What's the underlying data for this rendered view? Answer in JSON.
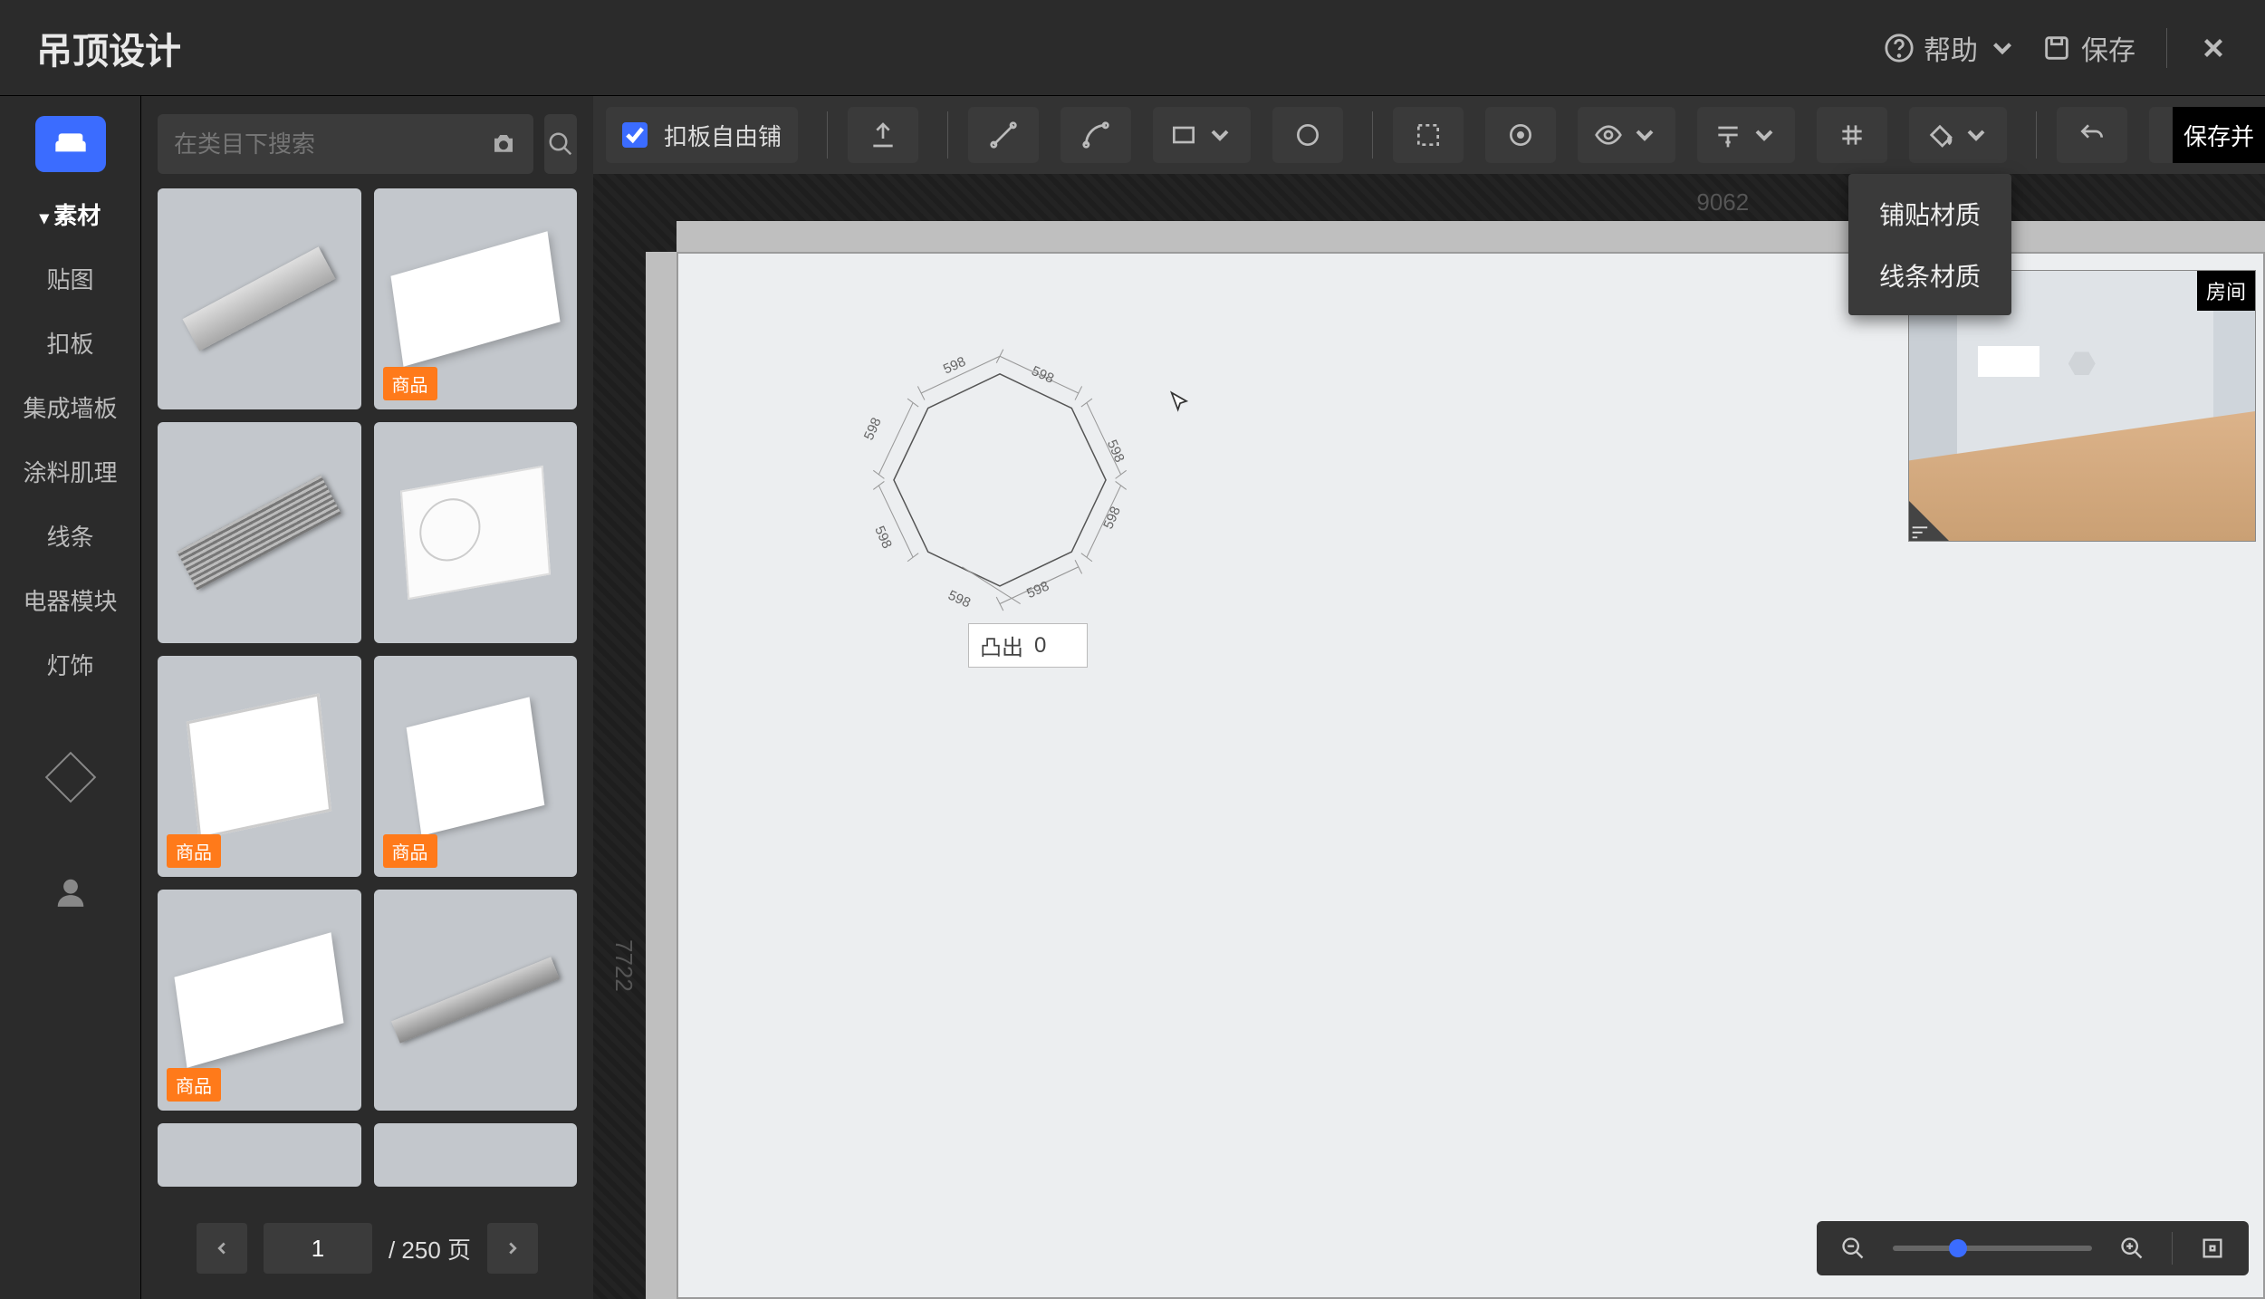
{
  "header": {
    "title": "吊顶设计",
    "help": "帮助",
    "save": "保存"
  },
  "search": {
    "placeholder": "在类目下搜索"
  },
  "leftnav": {
    "items": [
      "素材",
      "贴图",
      "扣板",
      "集成墙板",
      "涂料肌理",
      "线条",
      "电器模块",
      "灯饰"
    ],
    "active_index": 0
  },
  "materials": {
    "tag_label": "商品",
    "cards": [
      {
        "tag": false
      },
      {
        "tag": true
      },
      {
        "tag": false
      },
      {
        "tag": false
      },
      {
        "tag": true
      },
      {
        "tag": true
      },
      {
        "tag": true
      },
      {
        "tag": false
      },
      {
        "tag": false
      },
      {
        "tag": false
      }
    ]
  },
  "pager": {
    "current": "1",
    "total_label": "/ 250 页"
  },
  "toolbar": {
    "checkbox_label": "扣板自由铺",
    "save_pill": "保存并"
  },
  "dropdown": {
    "items": [
      "铺贴材质",
      "线条材质"
    ]
  },
  "canvas": {
    "ruler_width": "9062",
    "ruler_height": "7722",
    "octagon_edge": "598",
    "extrude_label": "凸出",
    "extrude_value": "0"
  },
  "preview": {
    "label": "房间"
  },
  "zoom": {
    "percent": 28
  }
}
